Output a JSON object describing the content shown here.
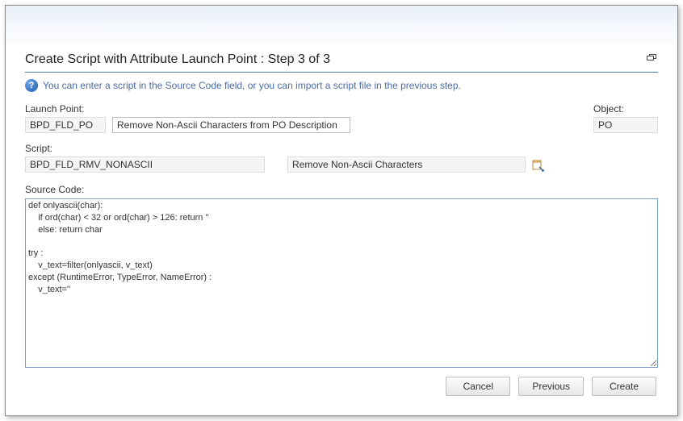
{
  "dialog": {
    "title": "Create Script with Attribute Launch Point : Step 3 of 3",
    "info_text": "You can enter a script in the Source Code field, or you can import a script file in the previous step."
  },
  "launch_point": {
    "label": "Launch Point:",
    "value": "BPD_FLD_PO",
    "description": "Remove Non-Ascii Characters from PO Description"
  },
  "object": {
    "label": "Object:",
    "value": "PO"
  },
  "script": {
    "label": "Script:",
    "name": "BPD_FLD_RMV_NONASCII",
    "description": "Remove Non-Ascii Characters"
  },
  "source_code": {
    "label": "Source Code:",
    "value": "def onlyascii(char):\n    if ord(char) < 32 or ord(char) > 126: return ''\n    else: return char\n\ntry :\n    v_text=filter(onlyascii, v_text)\nexcept (RuntimeError, TypeError, NameError) :\n    v_text=''"
  },
  "buttons": {
    "cancel": "Cancel",
    "previous": "Previous",
    "create": "Create"
  }
}
